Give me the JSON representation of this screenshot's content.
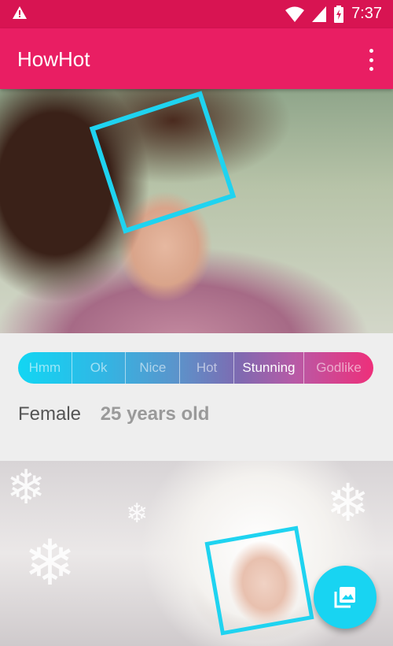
{
  "status_bar": {
    "time": "7:37",
    "icons": [
      "warning-icon",
      "wifi-icon",
      "signal-icon",
      "battery-charging-icon"
    ]
  },
  "app_bar": {
    "title": "HowHot",
    "menu_icon": "more-vert-icon"
  },
  "rating_scale": {
    "labels": [
      "Hmm",
      "Ok",
      "Nice",
      "Hot",
      "Stunning",
      "Godlike"
    ],
    "selected": "Stunning"
  },
  "result": {
    "gender": "Female",
    "age": "25 years old"
  },
  "fab": {
    "icon": "photo-library-icon"
  },
  "colors": {
    "primary": "#e91e63",
    "status_bar": "#d81452",
    "accent": "#18d4f2"
  }
}
